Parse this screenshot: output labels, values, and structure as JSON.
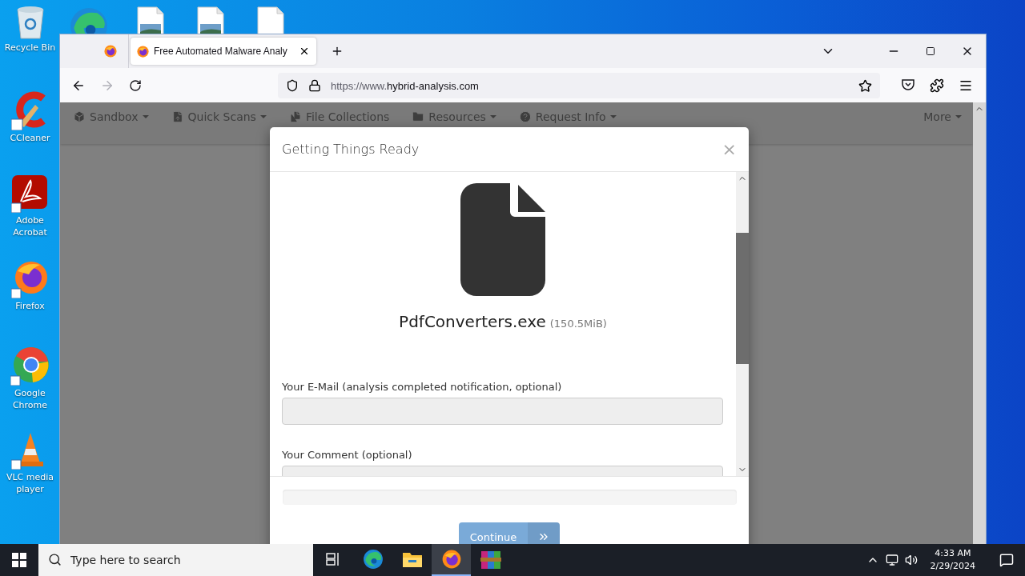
{
  "desktop": {
    "icons": [
      {
        "label": "Recycle Bin"
      },
      {
        "label": "CCleaner"
      },
      {
        "label": "Adobe Acrobat"
      },
      {
        "label": "Firefox"
      },
      {
        "label": "Google Chrome"
      },
      {
        "label": "VLC media player"
      }
    ]
  },
  "browser": {
    "tabs": [
      {
        "label": "Free Automated Malware Analy",
        "selected": true
      }
    ],
    "back": {
      "disabled": false
    },
    "forward": {
      "disabled": true
    },
    "url": {
      "prefix": "https://www.",
      "host": "hybrid-analysis.com"
    }
  },
  "site_nav": {
    "items": [
      {
        "label": "Sandbox",
        "dropdown": true
      },
      {
        "label": "Quick Scans",
        "dropdown": true
      },
      {
        "label": "File Collections",
        "dropdown": false
      },
      {
        "label": "Resources",
        "dropdown": true
      },
      {
        "label": "Request Info",
        "dropdown": true
      }
    ],
    "more": {
      "label": "More",
      "dropdown": true
    }
  },
  "modal": {
    "title": "Getting Things Ready",
    "close": "×",
    "file_name": "PdfConverters.exe",
    "file_size": "(150.5MiB)",
    "fields": [
      {
        "label": "Your E-Mail (analysis completed notification, optional)"
      },
      {
        "label": "Your Comment (optional)"
      }
    ],
    "progress": {
      "level": 0
    },
    "button": {
      "label": "Continue",
      "disabled": true
    }
  },
  "taskbar": {
    "search": {
      "placeholder": "Type here to search"
    },
    "apps": [
      {
        "selected": false
      },
      {
        "selected": false
      },
      {
        "selected": false
      },
      {
        "selected": true
      },
      {
        "selected": false
      }
    ],
    "time": "4:33 AM",
    "date": "2/29/2024"
  }
}
